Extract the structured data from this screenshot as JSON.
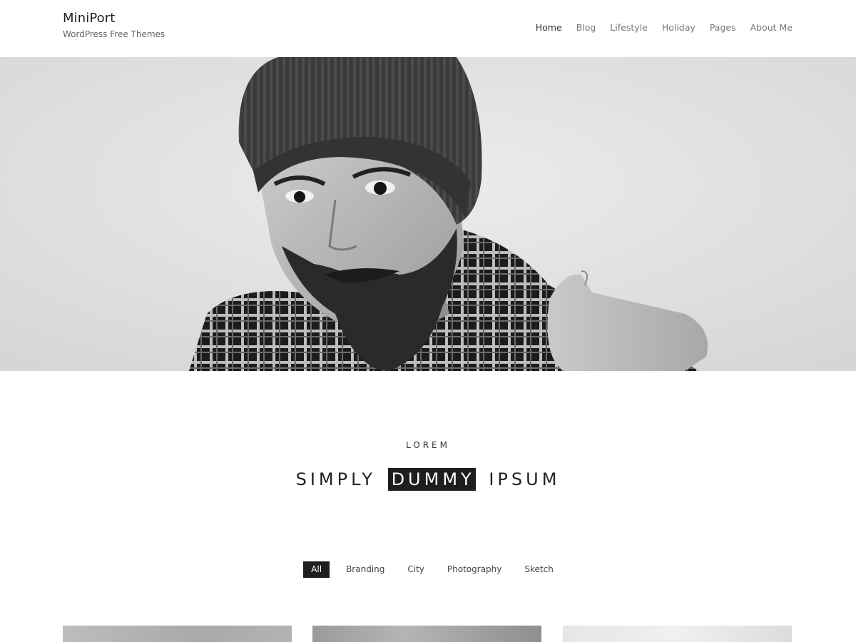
{
  "brand": {
    "title": "MiniPort",
    "tagline": "WordPress Free Themes"
  },
  "nav": {
    "items": [
      {
        "label": "Home",
        "active": true
      },
      {
        "label": "Blog",
        "active": false
      },
      {
        "label": "Lifestyle",
        "active": false
      },
      {
        "label": "Holiday",
        "active": false
      },
      {
        "label": "Pages",
        "active": false
      },
      {
        "label": "About Me",
        "active": false
      }
    ]
  },
  "hero": {
    "image": "hero-portrait-image",
    "tone": "grayscale"
  },
  "section": {
    "eyebrow": "LOREM",
    "headline_before": "SIMPLY",
    "headline_highlight": "DUMMY",
    "headline_after": "IPSUM"
  },
  "filters": {
    "items": [
      {
        "label": "All",
        "active": true
      },
      {
        "label": "Branding",
        "active": false
      },
      {
        "label": "City",
        "active": false
      },
      {
        "label": "Photography",
        "active": false
      },
      {
        "label": "Sketch",
        "active": false
      }
    ]
  },
  "portfolio": {
    "thumbs": [
      "portfolio-image-1",
      "portfolio-image-2",
      "portfolio-image-3"
    ]
  },
  "colors": {
    "highlight_bg": "#1e1e1e",
    "highlight_text": "#ffffff",
    "nav_text": "#777777",
    "nav_active": "#333333"
  }
}
